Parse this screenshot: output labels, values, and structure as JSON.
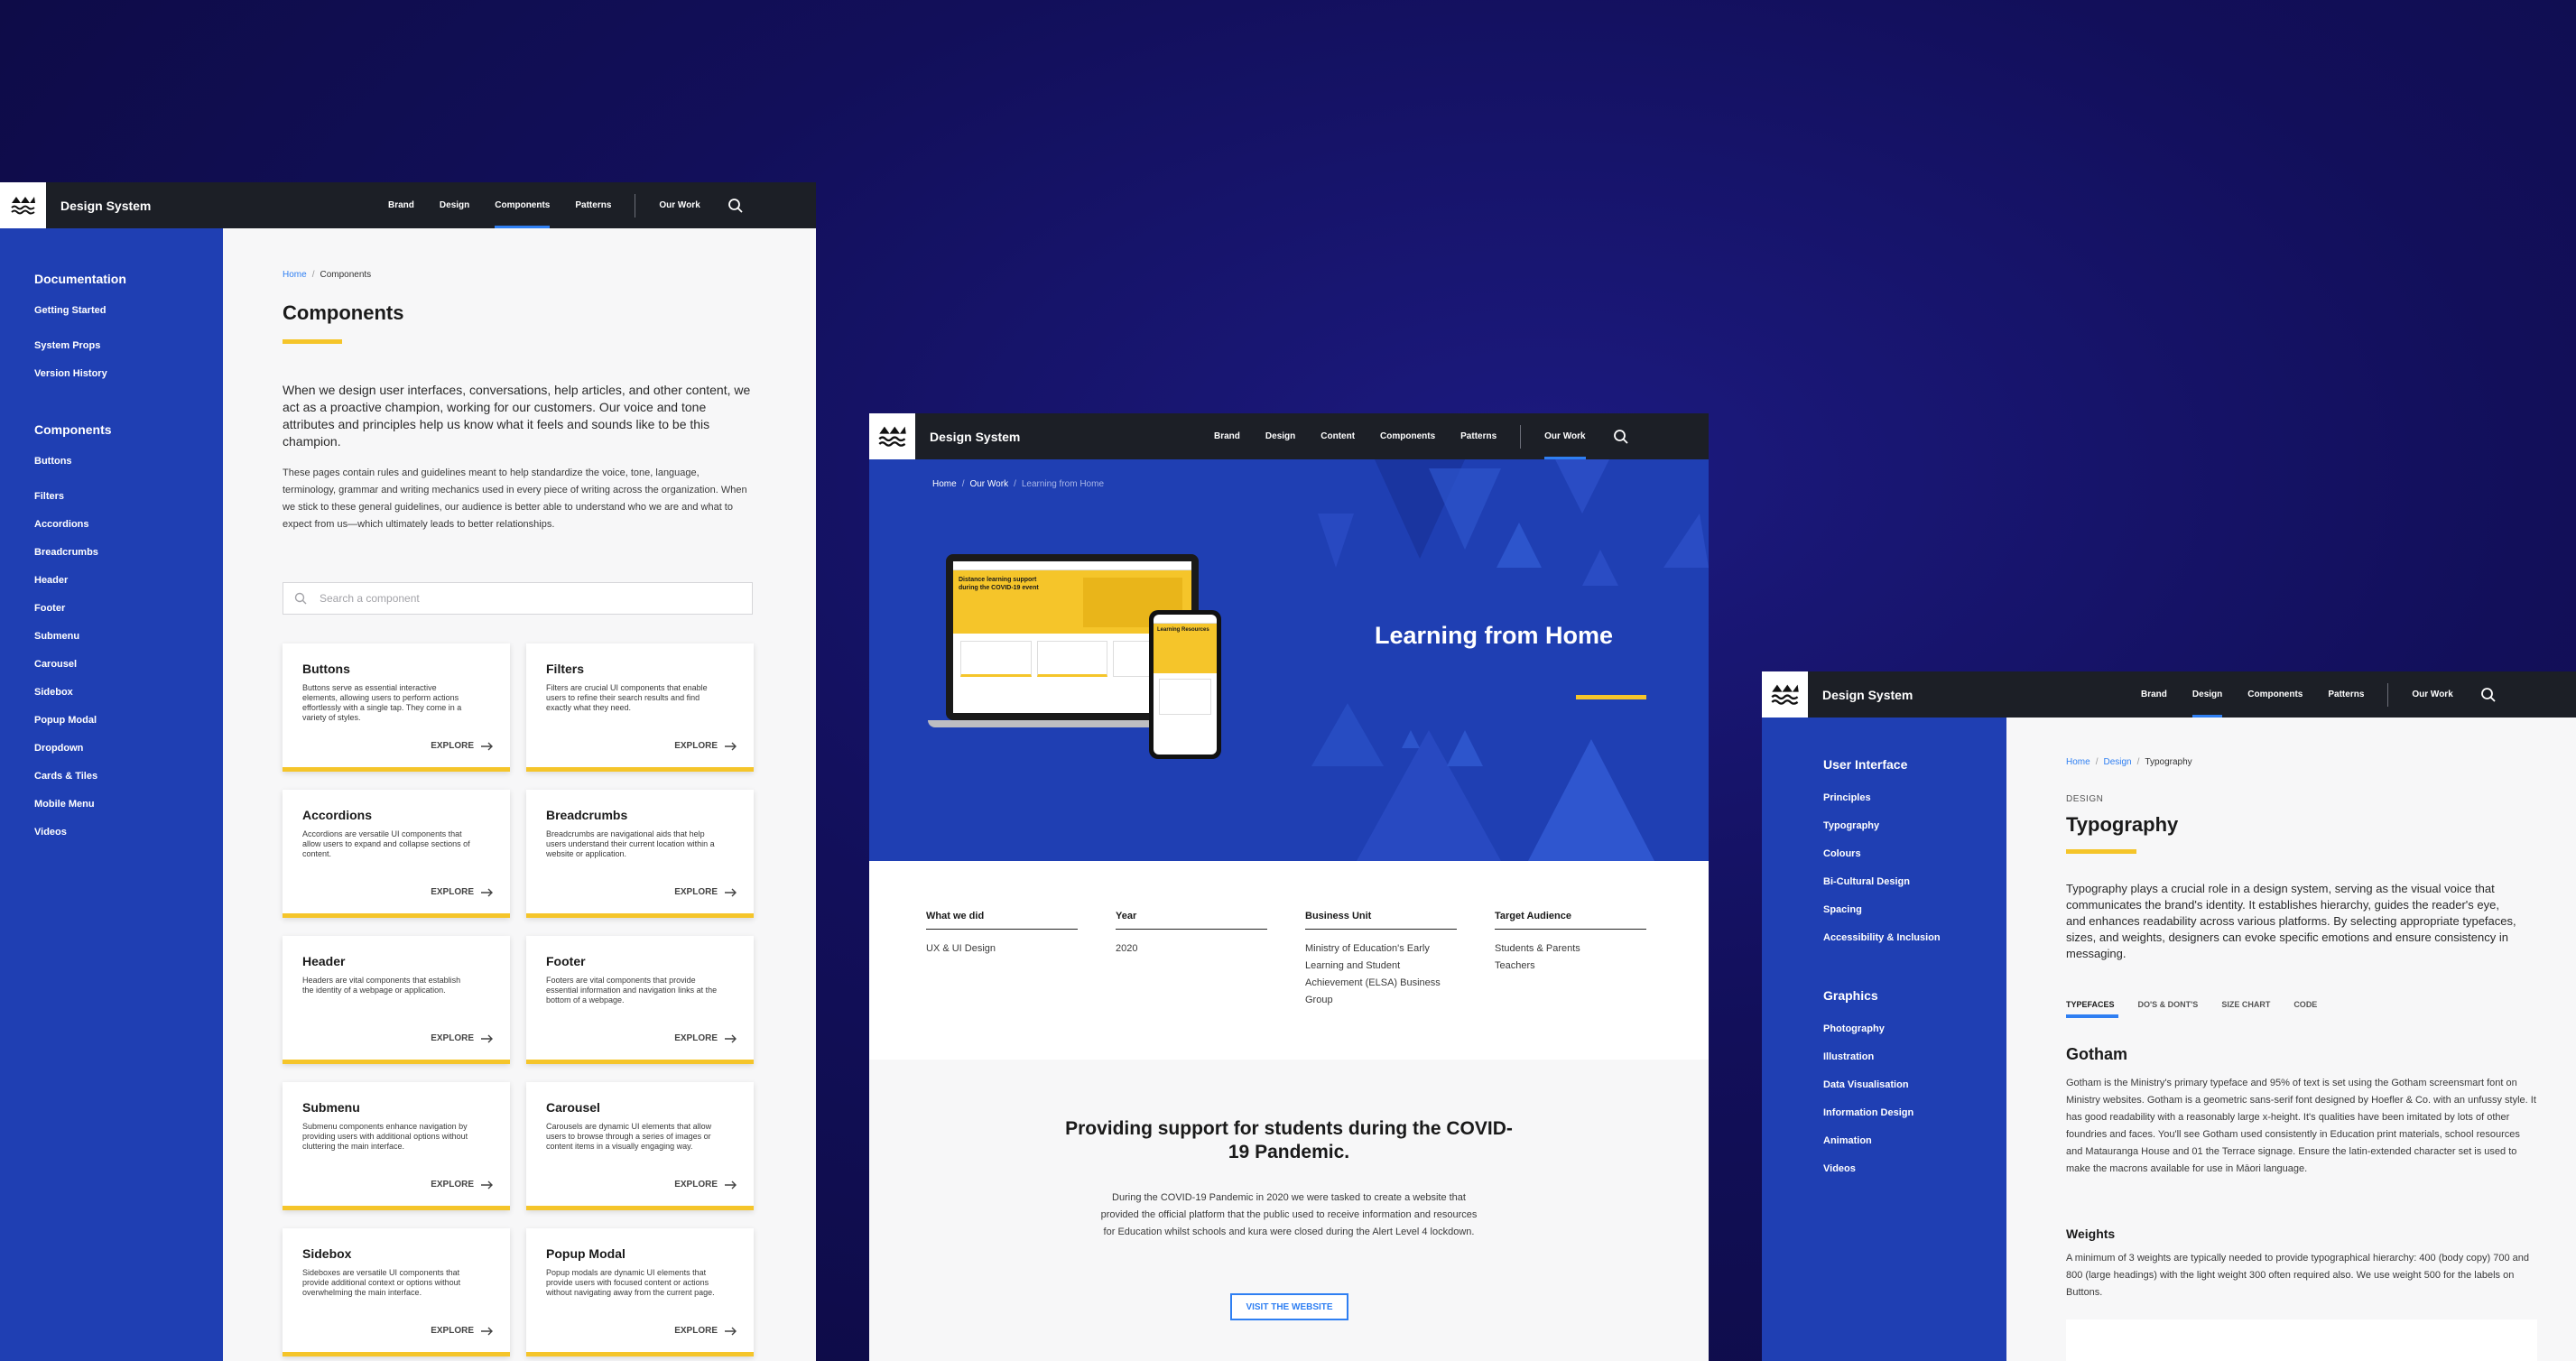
{
  "left": {
    "brand": "Design System",
    "nav": [
      "Brand",
      "Design",
      "Components",
      "Patterns"
    ],
    "nav_active": "Components",
    "nav_extra": "Our Work",
    "sidebar": {
      "sections": [
        {
          "title": "Documentation",
          "items": [
            "Getting Started",
            "System Props",
            "Version History"
          ]
        },
        {
          "title": "Components",
          "items": [
            "Buttons",
            "Filters",
            "Accordions",
            "Breadcrumbs",
            "Header",
            "Footer",
            "Submenu",
            "Carousel",
            "Sidebox",
            "Popup Modal",
            "Dropdown",
            "Cards & Tiles",
            "Mobile Menu",
            "Videos"
          ]
        }
      ]
    },
    "breadcrumb": {
      "home": "Home",
      "current": "Components"
    },
    "title": "Components",
    "lead": "When we design user interfaces, conversations, help articles, and other content, we act as a proactive champion, working for our customers. Our voice and tone attributes and principles help us know what it feels and sounds like to be this champion.",
    "body": "These pages contain rules and guidelines meant to help standardize the voice, tone, language, terminology, grammar and writing mechanics used in every piece of writing across the organization. When we stick to these general guidelines, our audience is better able to understand who we are and what to expect from us—which ultimately leads to better relationships.",
    "search_placeholder": "Search a component",
    "explore_label": "EXPLORE",
    "cards": [
      {
        "title": "Buttons",
        "desc": "Buttons serve as essential interactive elements, allowing users to perform actions effortlessly with a single tap. They come in a variety of styles."
      },
      {
        "title": "Filters",
        "desc": "Filters are crucial UI components that enable users to refine their search results and find exactly what they need."
      },
      {
        "title": "Accordions",
        "desc": "Accordions are versatile UI components that allow users to expand and collapse sections of content."
      },
      {
        "title": "Breadcrumbs",
        "desc": "Breadcrumbs are navigational aids that help users understand their current location within a website or application."
      },
      {
        "title": "Header",
        "desc": "Headers are vital components that establish the identity of a webpage or application."
      },
      {
        "title": "Footer",
        "desc": "Footers are vital components that provide essential information and navigation links at the bottom of a webpage."
      },
      {
        "title": "Submenu",
        "desc": "Submenu components enhance navigation by providing users with additional options without cluttering the main interface."
      },
      {
        "title": "Carousel",
        "desc": "Carousels are dynamic UI elements that allow users to browse through a series of images or content items in a visually engaging way."
      },
      {
        "title": "Sidebox",
        "desc": "Sideboxes are versatile UI components that provide additional context or options without overwhelming the main interface."
      },
      {
        "title": "Popup Modal",
        "desc": "Popup modals are dynamic UI elements that provide users with focused content or actions without navigating away from the current page."
      }
    ]
  },
  "mid": {
    "brand": "Design System",
    "nav": [
      "Brand",
      "Design",
      "Content",
      "Components",
      "Patterns"
    ],
    "nav_extra": "Our Work",
    "breadcrumb": {
      "home": "Home",
      "mid": "Our Work",
      "current": "Learning from Home"
    },
    "hero_title": "Learning from Home",
    "laptop_headline": "Distance learning support during the COVID-19 event",
    "phone_headline": "Learning Resources",
    "info": [
      {
        "label": "What we did",
        "value": "UX & UI Design"
      },
      {
        "label": "Year",
        "value": "2020"
      },
      {
        "label": "Business Unit",
        "value": "Ministry of Education's Early Learning and Student Achievement (ELSA) Business Group"
      },
      {
        "label": "Target Audience",
        "value": "Students & Parents\nTeachers"
      }
    ],
    "section_title": "Providing support for students during the COVID-19 Pandemic.",
    "section_body": "During the COVID-19 Pandemic in 2020 we were tasked to create a website that provided the official platform that the public used to receive information and resources for Education whilst schools and kura were closed during the Alert Level 4 lockdown.",
    "visit_label": "VISIT THE WEBSITE"
  },
  "right": {
    "brand": "Design System",
    "nav": [
      "Brand",
      "Design",
      "Components",
      "Patterns"
    ],
    "nav_active": "Design",
    "nav_extra": "Our Work",
    "sidebar": {
      "sections": [
        {
          "title": "User Interface",
          "items": [
            "Principles",
            "Typography",
            "Colours",
            "Bi-Cultural Design",
            "Spacing",
            "Accessibility & Inclusion"
          ]
        },
        {
          "title": "Graphics",
          "items": [
            "Photography",
            "Illustration",
            "Data Visualisation",
            "Information Design",
            "Animation",
            "Videos"
          ]
        }
      ]
    },
    "breadcrumb": {
      "home": "Home",
      "mid": "Design",
      "current": "Typography"
    },
    "eyebrow": "DESIGN",
    "title": "Typography",
    "lead": "Typography plays a crucial role in a design system, serving as the visual voice that communicates the brand's identity. It establishes hierarchy, guides the reader's eye, and enhances readability across various platforms. By selecting appropriate typefaces, sizes, and weights, designers can evoke specific emotions and ensure consistency in messaging.",
    "tabs": [
      "TYPEFACES",
      "DO'S & DONT'S",
      "SIZE CHART",
      "CODE"
    ],
    "typeface_title": "Gotham",
    "typeface_body": "Gotham is the Ministry's primary typeface and 95% of text is set using the Gotham screensmart font on Ministry websites. Gotham is a geometric sans-serif font designed by Hoefler & Co. with an unfussy style. It has good readability with a reasonably large x-height. It's qualities have been imitated by lots of other foundries and faces. You'll see Gotham used consistently in Education print materials, school resources and Matauranga House and 01 the Terrace signage. Ensure the latin-extended character set is used to make the macrons available for use in Māori language.",
    "weights_title": "Weights",
    "weights_body": "A minimum of 3 weights are typically needed to provide typographical hierarchy: 400 (body copy) 700 and 800 (large headings) with the light weight 300 often required also. We use weight 500 for the labels on Buttons."
  },
  "colors": {
    "primary": "#1f3fb3",
    "accent": "#f5c52a",
    "link": "#2f7ff2",
    "topbar": "#1c1f26"
  }
}
